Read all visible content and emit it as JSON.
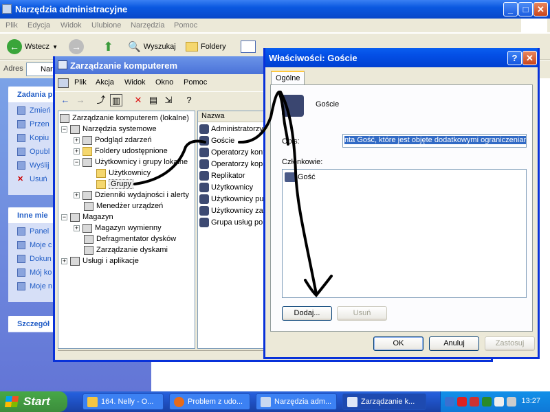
{
  "explorer": {
    "title": "Narzędzia administracyjne",
    "menu": [
      "Plik",
      "Edycja",
      "Widok",
      "Ulubione",
      "Narzędzia",
      "Pomoc"
    ],
    "toolbar": {
      "back": "Wstecz",
      "search": "Wyszukaj",
      "folders": "Foldery"
    },
    "address_label": "Adres",
    "address_value": "Nar",
    "tasks_header": "Zadania p",
    "task_links": [
      "Zmień",
      "Przen",
      "Kopiu",
      "Opubl",
      "Wyślij",
      "Usuń"
    ],
    "other_header": "Inne mie",
    "other_links": [
      "Panel",
      "Moje c",
      "Dokun",
      "Mój ko",
      "Moje n"
    ],
    "details_header": "Szczegół"
  },
  "mmc": {
    "title": "Zarządzanie komputerem",
    "menu": [
      "Plik",
      "Akcja",
      "Widok",
      "Okno",
      "Pomoc"
    ],
    "tree": [
      "Zarządzanie komputerem (lokalne)",
      "Narzędzia systemowe",
      "Podgląd zdarzeń",
      "Foldery udostępnione",
      "Użytkownicy i grupy lokalne",
      "Użytkownicy",
      "Grupy",
      "Dzienniki wydajności i alerty",
      "Menedżer urządzeń",
      "Magazyn",
      "Magazyn wymienny",
      "Defragmentator dysków",
      "Zarządzanie dyskami",
      "Usługi i aplikacje"
    ],
    "list_header": "Nazwa",
    "list": [
      "Administratorzy",
      "Goście",
      "Operatorzy konfi",
      "Operatorzy kopii",
      "Replikator",
      "Użytkownicy",
      "Użytkownicy pulp",
      "Użytkownicy zaa",
      "Grupa usług pom"
    ]
  },
  "dialog": {
    "title": "Właściwości: Goście",
    "tab": "Ogólne",
    "group_name": "Goście",
    "opis_label": "Opis:",
    "opis_value": "nta Gość, które jest objęte dodatkowymi ograniczeniami",
    "members_label": "Członkowie:",
    "members": [
      "Gość"
    ],
    "add": "Dodaj...",
    "remove": "Usuń",
    "ok": "OK",
    "cancel": "Anuluj",
    "apply": "Zastosuj"
  },
  "taskbar": {
    "start": "Start",
    "tasks": [
      "164. Nelly - O...",
      "Problem z udo...",
      "Narzędzia adm...",
      "Zarządzanie k..."
    ],
    "clock": "13:27"
  },
  "colors": {
    "xp_blue": "#0a58e0",
    "dialog_face": "#ece9d8",
    "selection": "#316ac5",
    "scribble": "#000000"
  }
}
